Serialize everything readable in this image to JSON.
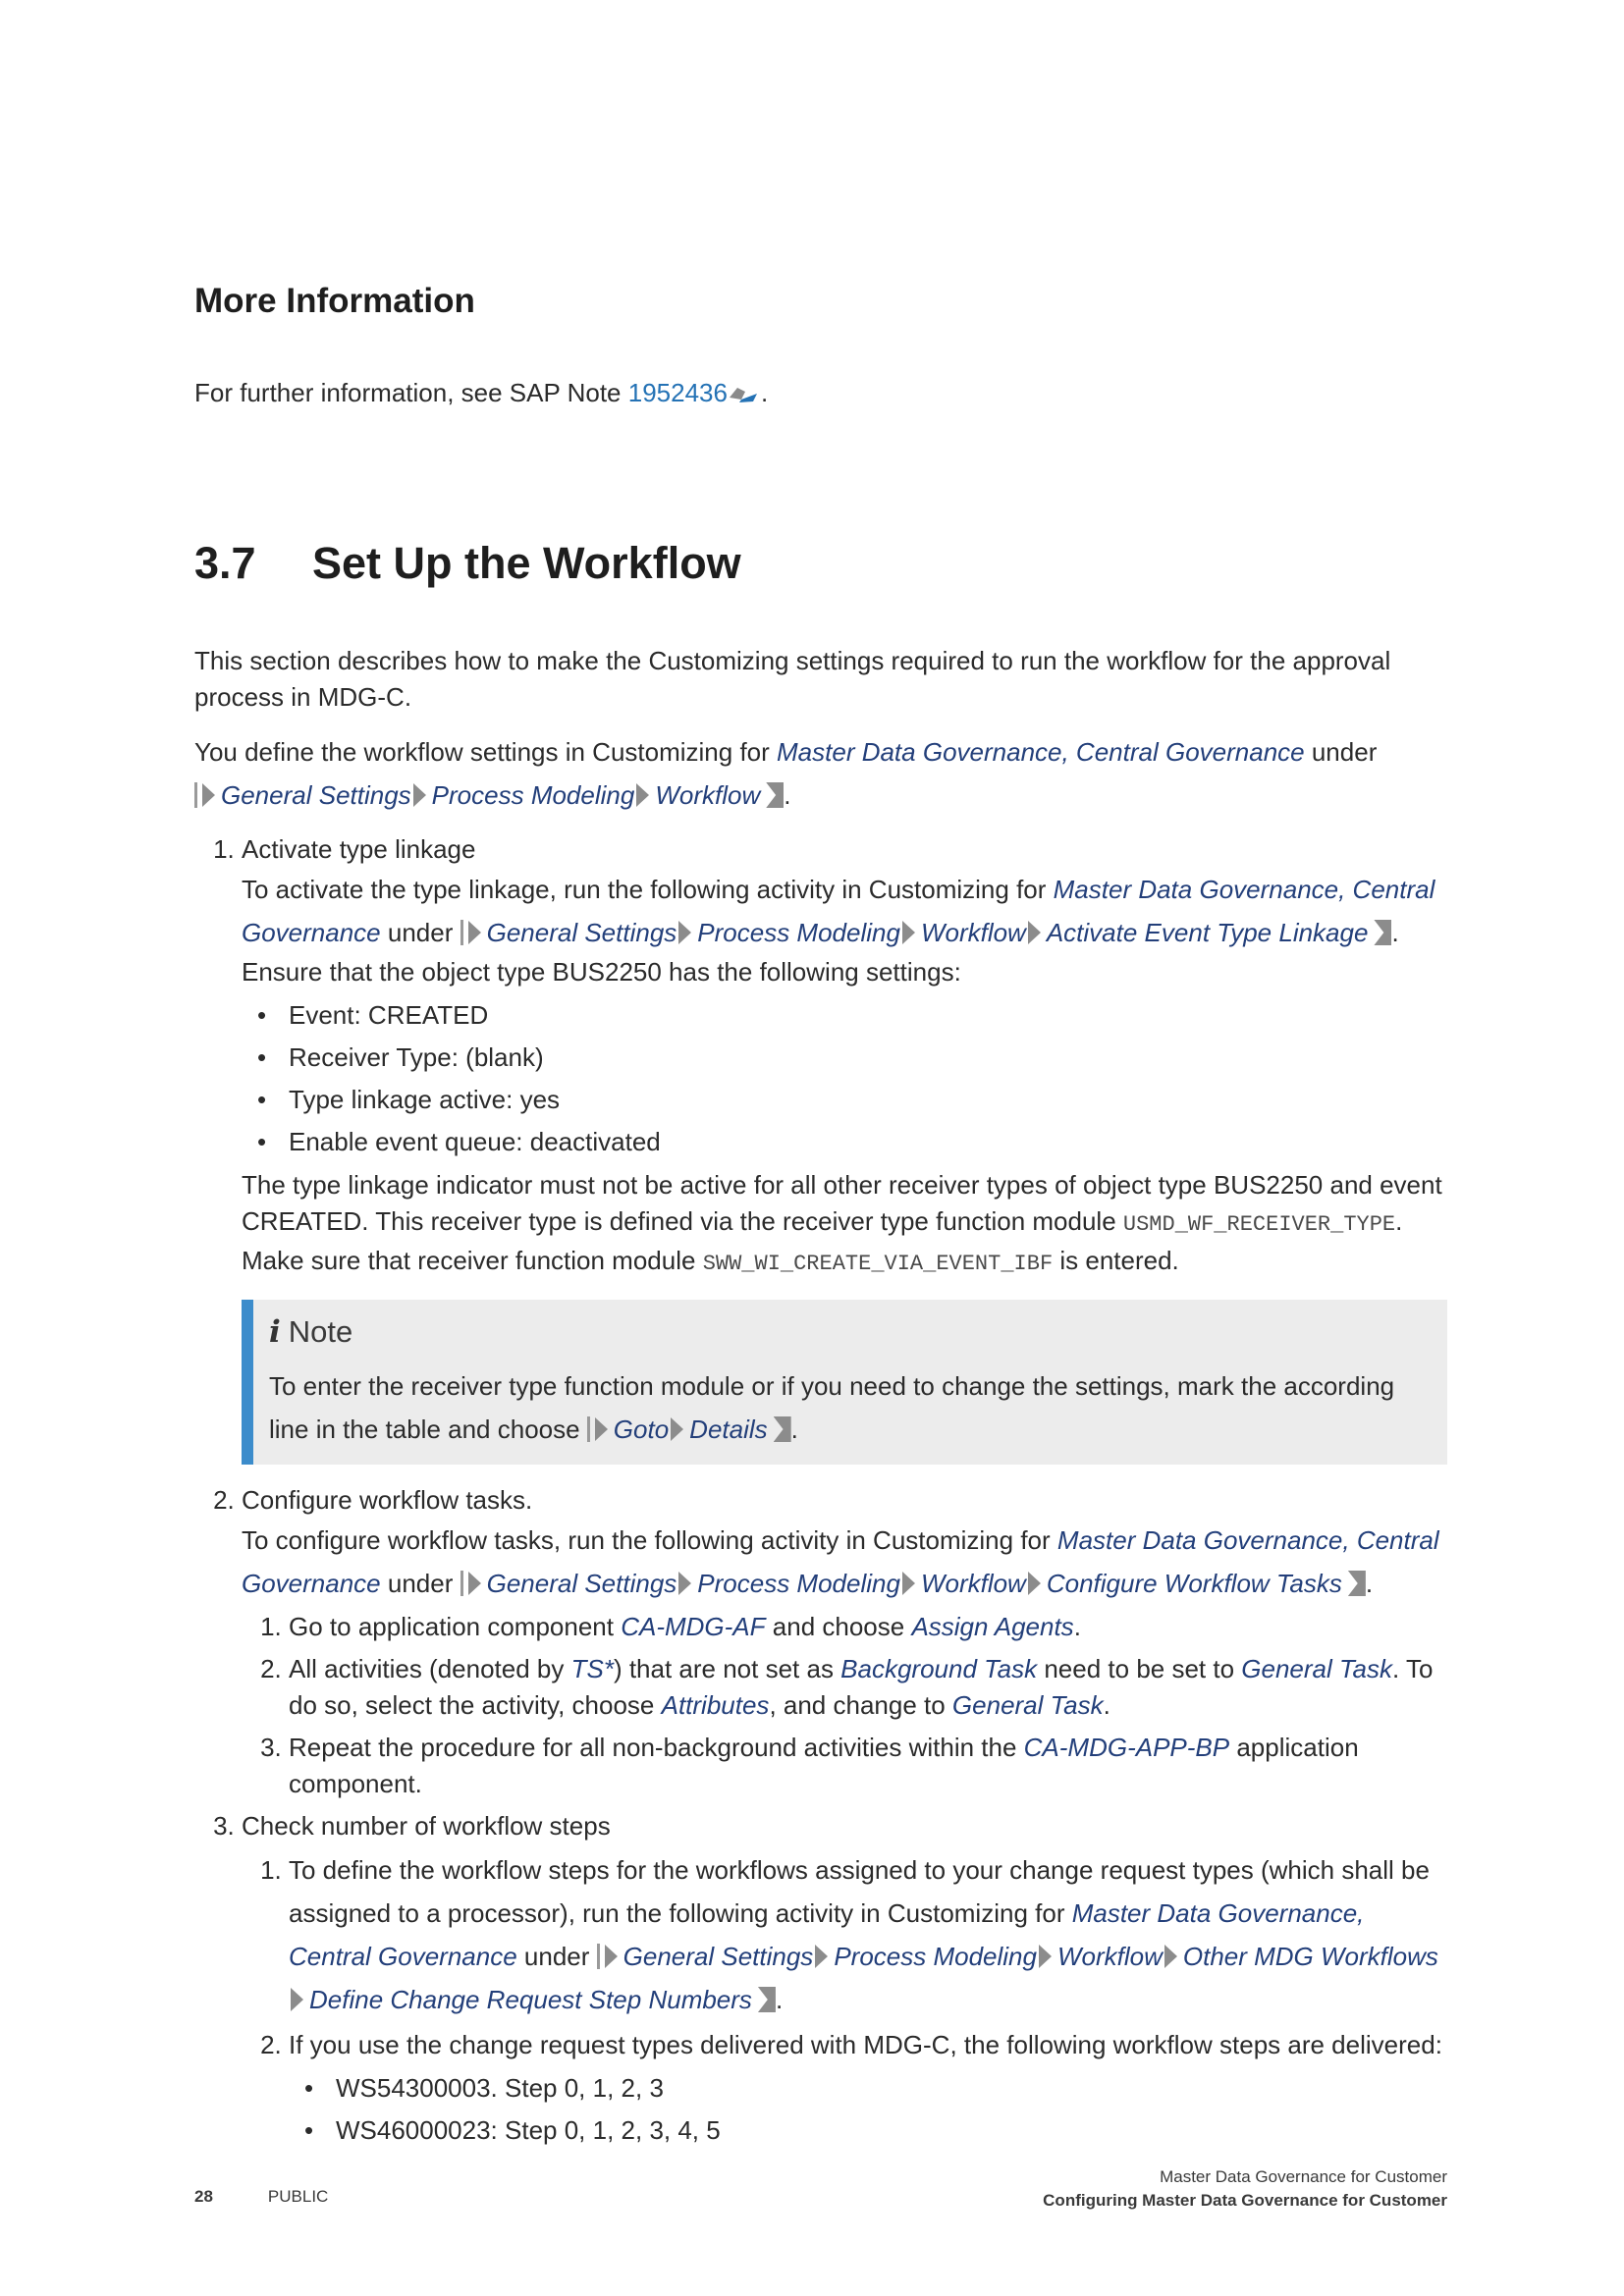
{
  "more_info": {
    "heading": "More Information",
    "text_before": "For further information, see SAP Note ",
    "note_link": "1952436",
    "text_after": "."
  },
  "section": {
    "number": "3.7",
    "title": "Set Up the Workflow",
    "intro": "This section describes how to make the Customizing settings required to run the workflow for the approval process in MDG-C.",
    "define_before": "You define the workflow settings in Customizing for ",
    "define_area": "Master Data Governance, Central Governance",
    "define_under": " under",
    "define_path": [
      "General Settings",
      "Process Modeling",
      "Workflow"
    ]
  },
  "step1": {
    "title": "Activate type linkage",
    "line_before": "To activate the type linkage, run the following activity in Customizing for ",
    "area": "Master Data Governance, Central Governance",
    "under": " under ",
    "path": [
      "General Settings",
      "Process Modeling",
      "Workflow",
      "Activate Event Type Linkage"
    ],
    "ensure": "Ensure that the object type BUS2250 has the following settings:",
    "bullets": [
      "Event: CREATED",
      "Receiver Type: (blank)",
      "Type linkage active: yes",
      "Enable event queue: deactivated"
    ],
    "indicator_text": "The type linkage indicator must not be active for all other receiver types of object type BUS2250 and event CREATED. This receiver type is defined via the receiver type function module ",
    "fm_receiver": "USMD_WF_RECEIVER_TYPE",
    "make_sure": "Make sure that receiver function module ",
    "fm_create": "SWW_WI_CREATE_VIA_EVENT_IBF",
    "entered": " is entered."
  },
  "note": {
    "title": "Note",
    "text": "To enter the receiver type function module or if you need to change the settings, mark the according line in the table and choose ",
    "path": [
      "Goto",
      "Details"
    ]
  },
  "step2": {
    "title": "Configure workflow tasks.",
    "line_before": "To configure workflow tasks, run the following activity in Customizing for ",
    "area": "Master Data Governance, Central Governance",
    "under": " under ",
    "path": [
      "General Settings",
      "Process Modeling",
      "Workflow",
      "Configure Workflow Tasks"
    ],
    "sub1_before": "Go to application component ",
    "sub1_comp": "CA-MDG-AF",
    "sub1_mid": " and choose ",
    "sub1_action": "Assign Agents",
    "sub2_a": "All activities (denoted by ",
    "sub2_ts": "TS*",
    "sub2_b": ") that are not set as ",
    "sub2_bg": "Background Task",
    "sub2_c": " need to be set to ",
    "sub2_gt": "General Task",
    "sub2_d": ". To do so, select the activity, choose ",
    "sub2_attr": "Attributes",
    "sub2_e": ", and change to ",
    "sub2_gt2": "General Task",
    "sub3_before": "Repeat the procedure for all non-background activities within the ",
    "sub3_comp": "CA-MDG-APP-BP",
    "sub3_after": " application component."
  },
  "step3": {
    "title": "Check number of workflow steps",
    "sub1_before": "To define the workflow steps for the workflows assigned to your change request types (which shall be assigned to a processor), run the following activity in Customizing for ",
    "area": "Master Data Governance, Central Governance",
    "under": " under ",
    "path": [
      "General Settings",
      "Process Modeling",
      "Workflow",
      "Other MDG Workflows",
      "Define Change Request Step Numbers"
    ],
    "sub2": "If you use the change request types delivered with MDG-C, the following workflow steps are delivered:",
    "bullets": [
      "WS54300003. Step 0, 1, 2, 3",
      "WS46000023: Step 0, 1, 2, 3, 4, 5"
    ]
  },
  "footer": {
    "page_number": "28",
    "classification": "PUBLIC",
    "doc_title": "Master Data Governance for Customer",
    "chapter": "Configuring Master Data Governance for Customer"
  }
}
